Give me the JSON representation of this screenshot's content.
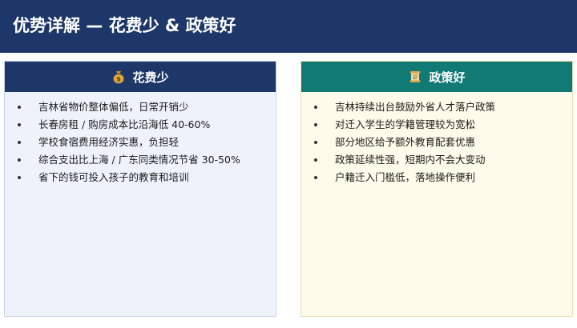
{
  "page": {
    "title": "优势详解 — 花费少 & 政策好"
  },
  "left_panel": {
    "title": "花费少",
    "icon": "money-bag-icon",
    "header_color": "#1c3768",
    "items": [
      "吉林省物价整体偏低，日常开销少",
      "长春房租 / 购房成本比沿海低 40-60%",
      "学校食宿费用经济实惠，负担轻",
      "综合支出比上海 / 广东同类情况节省 30-50%",
      "省下的钱可投入孩子的教育和培训"
    ]
  },
  "right_panel": {
    "title": "政策好",
    "icon": "scroll-icon",
    "header_color": "#127a75",
    "items": [
      "吉林持续出台鼓励外省人才落户政策",
      "对迁入学生的学籍管理较为宽松",
      "部分地区给予额外教育配套优惠",
      "政策延续性强，短期内不会大变动",
      "户籍迁入门槛低，落地操作便利"
    ]
  }
}
